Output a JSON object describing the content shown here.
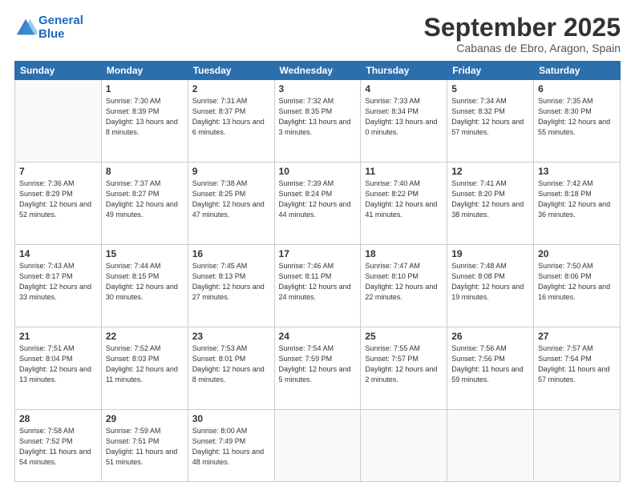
{
  "header": {
    "logo_line1": "General",
    "logo_line2": "Blue",
    "month": "September 2025",
    "location": "Cabanas de Ebro, Aragon, Spain"
  },
  "days_of_week": [
    "Sunday",
    "Monday",
    "Tuesday",
    "Wednesday",
    "Thursday",
    "Friday",
    "Saturday"
  ],
  "weeks": [
    [
      {
        "day": null
      },
      {
        "day": 1,
        "sunrise": "7:30 AM",
        "sunset": "8:39 PM",
        "daylight": "13 hours and 8 minutes."
      },
      {
        "day": 2,
        "sunrise": "7:31 AM",
        "sunset": "8:37 PM",
        "daylight": "13 hours and 6 minutes."
      },
      {
        "day": 3,
        "sunrise": "7:32 AM",
        "sunset": "8:35 PM",
        "daylight": "13 hours and 3 minutes."
      },
      {
        "day": 4,
        "sunrise": "7:33 AM",
        "sunset": "8:34 PM",
        "daylight": "13 hours and 0 minutes."
      },
      {
        "day": 5,
        "sunrise": "7:34 AM",
        "sunset": "8:32 PM",
        "daylight": "12 hours and 57 minutes."
      },
      {
        "day": 6,
        "sunrise": "7:35 AM",
        "sunset": "8:30 PM",
        "daylight": "12 hours and 55 minutes."
      }
    ],
    [
      {
        "day": 7,
        "sunrise": "7:36 AM",
        "sunset": "8:29 PM",
        "daylight": "12 hours and 52 minutes."
      },
      {
        "day": 8,
        "sunrise": "7:37 AM",
        "sunset": "8:27 PM",
        "daylight": "12 hours and 49 minutes."
      },
      {
        "day": 9,
        "sunrise": "7:38 AM",
        "sunset": "8:25 PM",
        "daylight": "12 hours and 47 minutes."
      },
      {
        "day": 10,
        "sunrise": "7:39 AM",
        "sunset": "8:24 PM",
        "daylight": "12 hours and 44 minutes."
      },
      {
        "day": 11,
        "sunrise": "7:40 AM",
        "sunset": "8:22 PM",
        "daylight": "12 hours and 41 minutes."
      },
      {
        "day": 12,
        "sunrise": "7:41 AM",
        "sunset": "8:20 PM",
        "daylight": "12 hours and 38 minutes."
      },
      {
        "day": 13,
        "sunrise": "7:42 AM",
        "sunset": "8:18 PM",
        "daylight": "12 hours and 36 minutes."
      }
    ],
    [
      {
        "day": 14,
        "sunrise": "7:43 AM",
        "sunset": "8:17 PM",
        "daylight": "12 hours and 33 minutes."
      },
      {
        "day": 15,
        "sunrise": "7:44 AM",
        "sunset": "8:15 PM",
        "daylight": "12 hours and 30 minutes."
      },
      {
        "day": 16,
        "sunrise": "7:45 AM",
        "sunset": "8:13 PM",
        "daylight": "12 hours and 27 minutes."
      },
      {
        "day": 17,
        "sunrise": "7:46 AM",
        "sunset": "8:11 PM",
        "daylight": "12 hours and 24 minutes."
      },
      {
        "day": 18,
        "sunrise": "7:47 AM",
        "sunset": "8:10 PM",
        "daylight": "12 hours and 22 minutes."
      },
      {
        "day": 19,
        "sunrise": "7:48 AM",
        "sunset": "8:08 PM",
        "daylight": "12 hours and 19 minutes."
      },
      {
        "day": 20,
        "sunrise": "7:50 AM",
        "sunset": "8:06 PM",
        "daylight": "12 hours and 16 minutes."
      }
    ],
    [
      {
        "day": 21,
        "sunrise": "7:51 AM",
        "sunset": "8:04 PM",
        "daylight": "12 hours and 13 minutes."
      },
      {
        "day": 22,
        "sunrise": "7:52 AM",
        "sunset": "8:03 PM",
        "daylight": "12 hours and 11 minutes."
      },
      {
        "day": 23,
        "sunrise": "7:53 AM",
        "sunset": "8:01 PM",
        "daylight": "12 hours and 8 minutes."
      },
      {
        "day": 24,
        "sunrise": "7:54 AM",
        "sunset": "7:59 PM",
        "daylight": "12 hours and 5 minutes."
      },
      {
        "day": 25,
        "sunrise": "7:55 AM",
        "sunset": "7:57 PM",
        "daylight": "12 hours and 2 minutes."
      },
      {
        "day": 26,
        "sunrise": "7:56 AM",
        "sunset": "7:56 PM",
        "daylight": "11 hours and 59 minutes."
      },
      {
        "day": 27,
        "sunrise": "7:57 AM",
        "sunset": "7:54 PM",
        "daylight": "11 hours and 57 minutes."
      }
    ],
    [
      {
        "day": 28,
        "sunrise": "7:58 AM",
        "sunset": "7:52 PM",
        "daylight": "11 hours and 54 minutes."
      },
      {
        "day": 29,
        "sunrise": "7:59 AM",
        "sunset": "7:51 PM",
        "daylight": "11 hours and 51 minutes."
      },
      {
        "day": 30,
        "sunrise": "8:00 AM",
        "sunset": "7:49 PM",
        "daylight": "11 hours and 48 minutes."
      },
      {
        "day": null
      },
      {
        "day": null
      },
      {
        "day": null
      },
      {
        "day": null
      }
    ]
  ]
}
